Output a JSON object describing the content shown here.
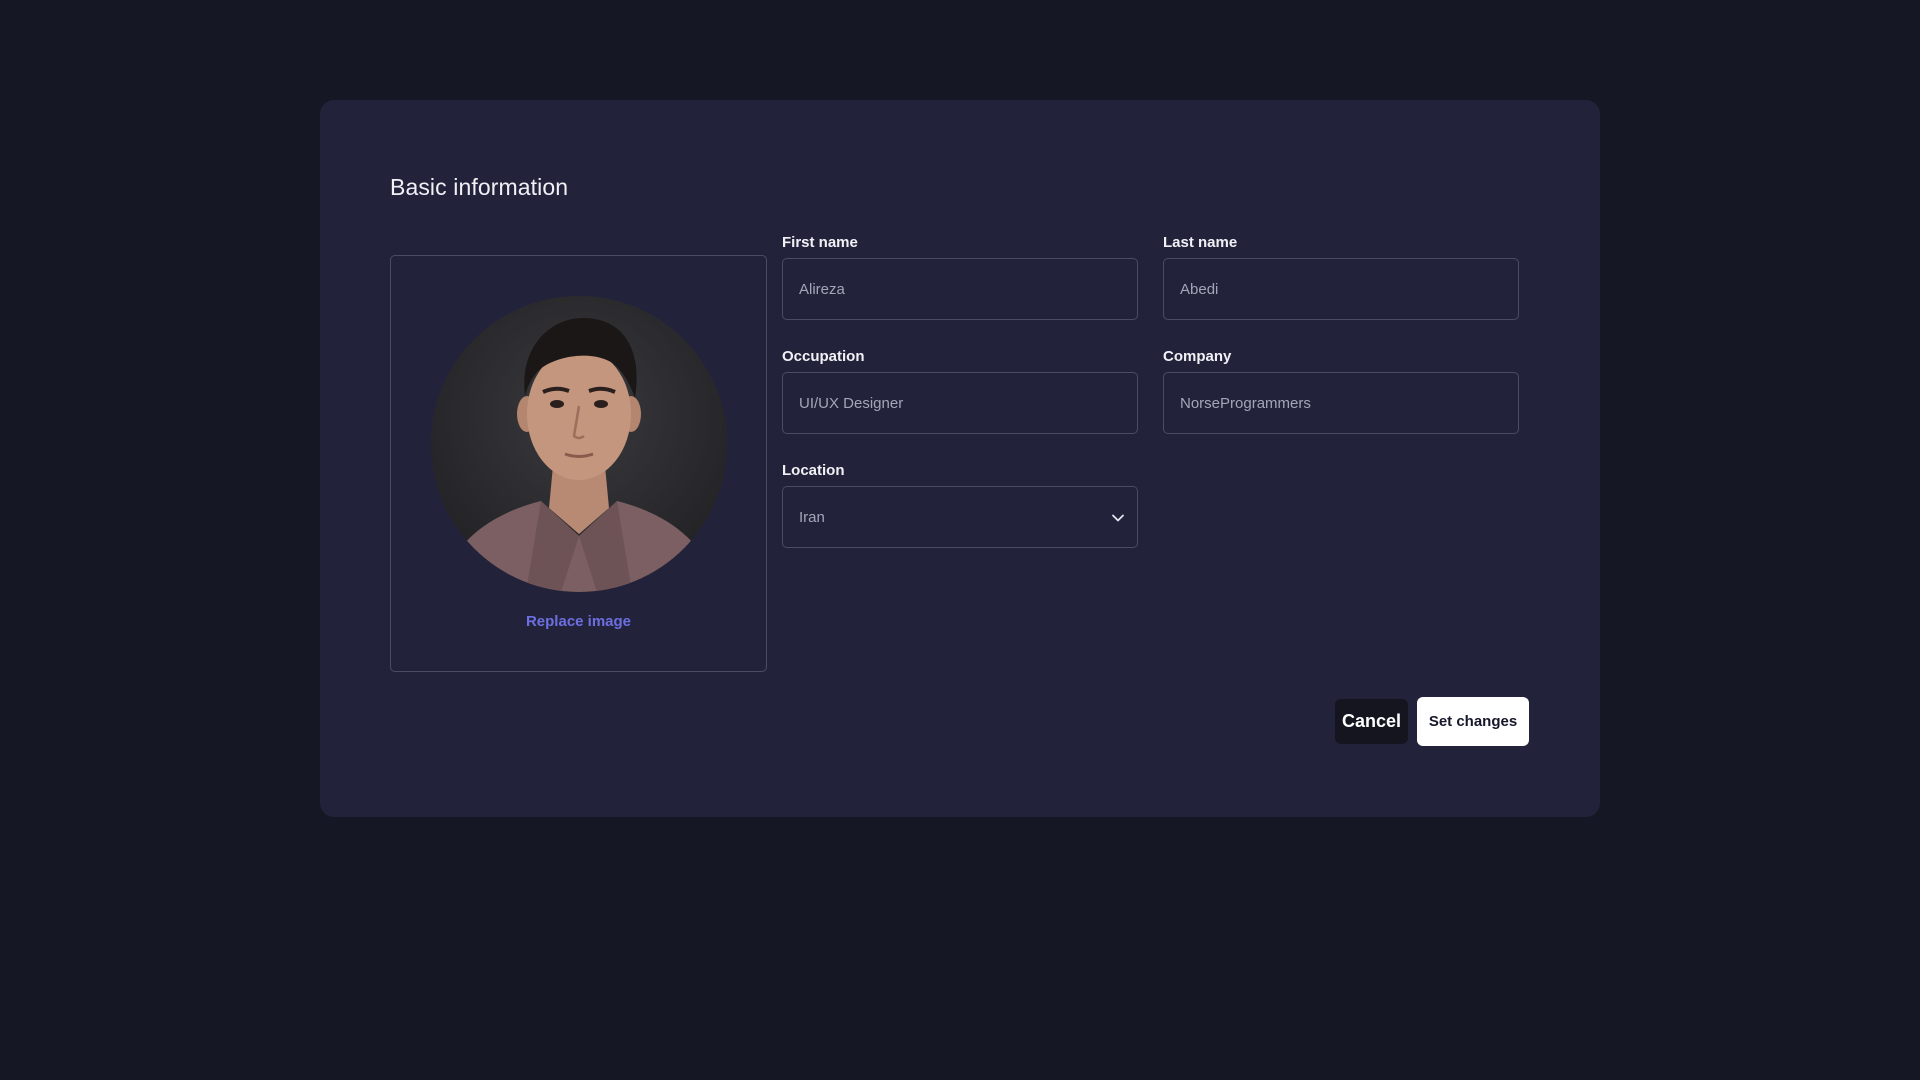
{
  "form": {
    "title": "Basic information",
    "photo": {
      "replace_label": "Replace image"
    },
    "fields": {
      "first_name": {
        "label": "First name",
        "value": "Alireza"
      },
      "last_name": {
        "label": "Last name",
        "value": "Abedi"
      },
      "occupation": {
        "label": "Occupation",
        "value": "UI/UX Designer"
      },
      "company": {
        "label": "Company",
        "value": "NorseProgrammers"
      },
      "location": {
        "label": "Location",
        "value": "Iran"
      }
    },
    "actions": {
      "cancel_label": "Cancel",
      "submit_label": "Set changes"
    }
  },
  "icons": {
    "location_dropdown": "chevron-down-icon"
  },
  "colors": {
    "page_background": "#151724",
    "card_background": "#22233b",
    "border": "#4a4c66",
    "link_accent": "#6d6ee0",
    "primary_button": "#ffffff",
    "cancel_button": "#15151f"
  }
}
